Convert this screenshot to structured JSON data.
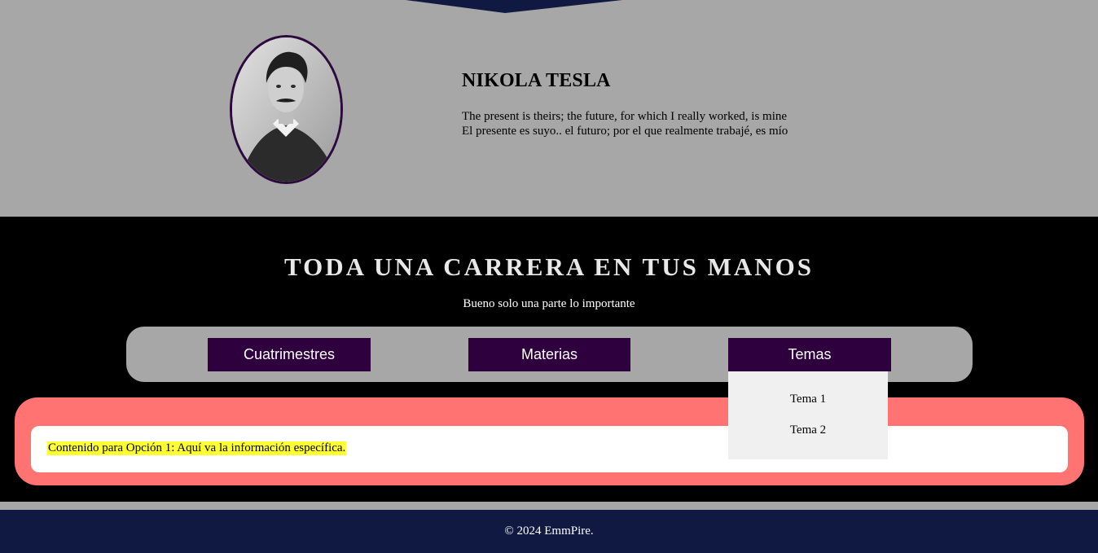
{
  "colors": {
    "hero_bg": "#a7a7a7",
    "banner": "#0f1941",
    "nav_button": "#2e003e",
    "panel": "#ff7373",
    "highlight": "#ffff33",
    "footer": "#0f1941"
  },
  "hero": {
    "name": "NIKOLA TESLA",
    "quote_en": "The present is theirs; the future, for which I really worked, is mine",
    "quote_es": "El presente es suyo.. el futuro; por el que realmente trabajé, es mío",
    "portrait_icon": "person-portrait"
  },
  "main": {
    "headline": "TODA UNA CARRERA EN TUS MANOS",
    "subheadline": "Bueno solo una parte lo importante"
  },
  "nav": {
    "buttons": [
      {
        "label": "Cuatrimestres"
      },
      {
        "label": "Materias"
      },
      {
        "label": "Temas"
      }
    ],
    "dropdown": [
      {
        "label": "Tema 1"
      },
      {
        "label": "Tema 2"
      }
    ]
  },
  "content": {
    "text": "Contenido para Opción 1: Aquí va la información específica."
  },
  "footer": {
    "text": "© 2024 EmmPire."
  }
}
